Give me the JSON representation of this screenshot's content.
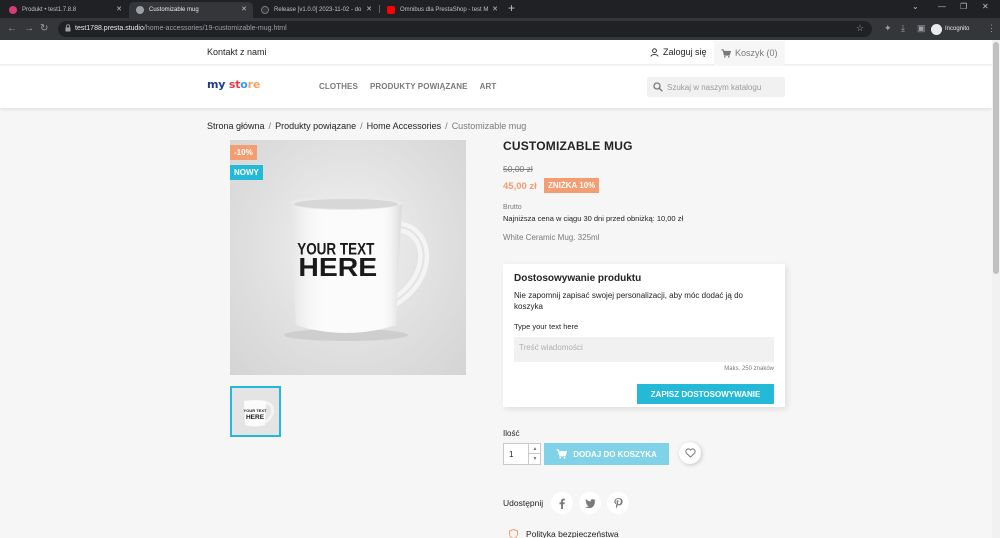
{
  "browser": {
    "tabs": [
      {
        "title": "Produkt • test1.7.8.8",
        "favicon_color": "#d63b7a"
      },
      {
        "title": "Customizable mug",
        "favicon_color": "#9aa0a6"
      },
      {
        "title": "Release [v1.0.0] 2023-11-02 - do",
        "favicon_color": "#333333"
      },
      {
        "title": "Omnibus dla PrestaShop - test M",
        "favicon_color": "#ff0000"
      }
    ],
    "url_host": "test1788.presta.studio",
    "url_path": "/home-accessories/19-customizable-mug.html",
    "profile_label": "Incognito"
  },
  "header": {
    "contact": "Kontakt z nami",
    "login": "Zaloguj się",
    "cart": "Koszyk (0)",
    "logo": {
      "part1": "my",
      "part2": "st",
      "part3": "o",
      "part4": "re"
    },
    "menu": [
      "CLOTHES",
      "PRODUKTY POWIĄZANE",
      "ART"
    ],
    "search_placeholder": "Szukaj w naszym katalogu"
  },
  "breadcrumb": [
    "Strona główna",
    "Produkty powiązane",
    "Home Accessories",
    "Customizable mug"
  ],
  "product": {
    "flags": {
      "discount": "-10%",
      "new": "NOWY"
    },
    "mug_text": [
      "YOUR TEXT",
      "HERE"
    ],
    "title": "CUSTOMIZABLE MUG",
    "old_price": "50,00 zł",
    "price": "45,00 zł",
    "discount_label": "ZNIŻKA 10%",
    "tax_label": "Brutto",
    "omnibus": "Najniższa cena w ciągu 30 dni przed obniżką: 10,00 zł",
    "short_description": "White Ceramic Mug. 325ml"
  },
  "customization": {
    "heading": "Dostosowywanie produktu",
    "note": "Nie zapomnij zapisać swojej personalizacji, aby móc dodać ją do koszyka",
    "field_label": "Type your text here",
    "placeholder": "Treść wiadomości",
    "max_chars": "Maks. 250 znaków",
    "save_button": "ZAPISZ DOSTOSOWYWANIE"
  },
  "purchase": {
    "quantity_label": "Ilość",
    "quantity": "1",
    "add_to_cart": "DODAJ DO KOSZYKA"
  },
  "share": {
    "label": "Udostępnij"
  },
  "reassurance": {
    "item": "Polityka bezpieczeństwa"
  },
  "colors": {
    "accent": "#24b9d7",
    "discount": "#f39d72",
    "add_to_cart_disabled": "#7fd2e7"
  }
}
